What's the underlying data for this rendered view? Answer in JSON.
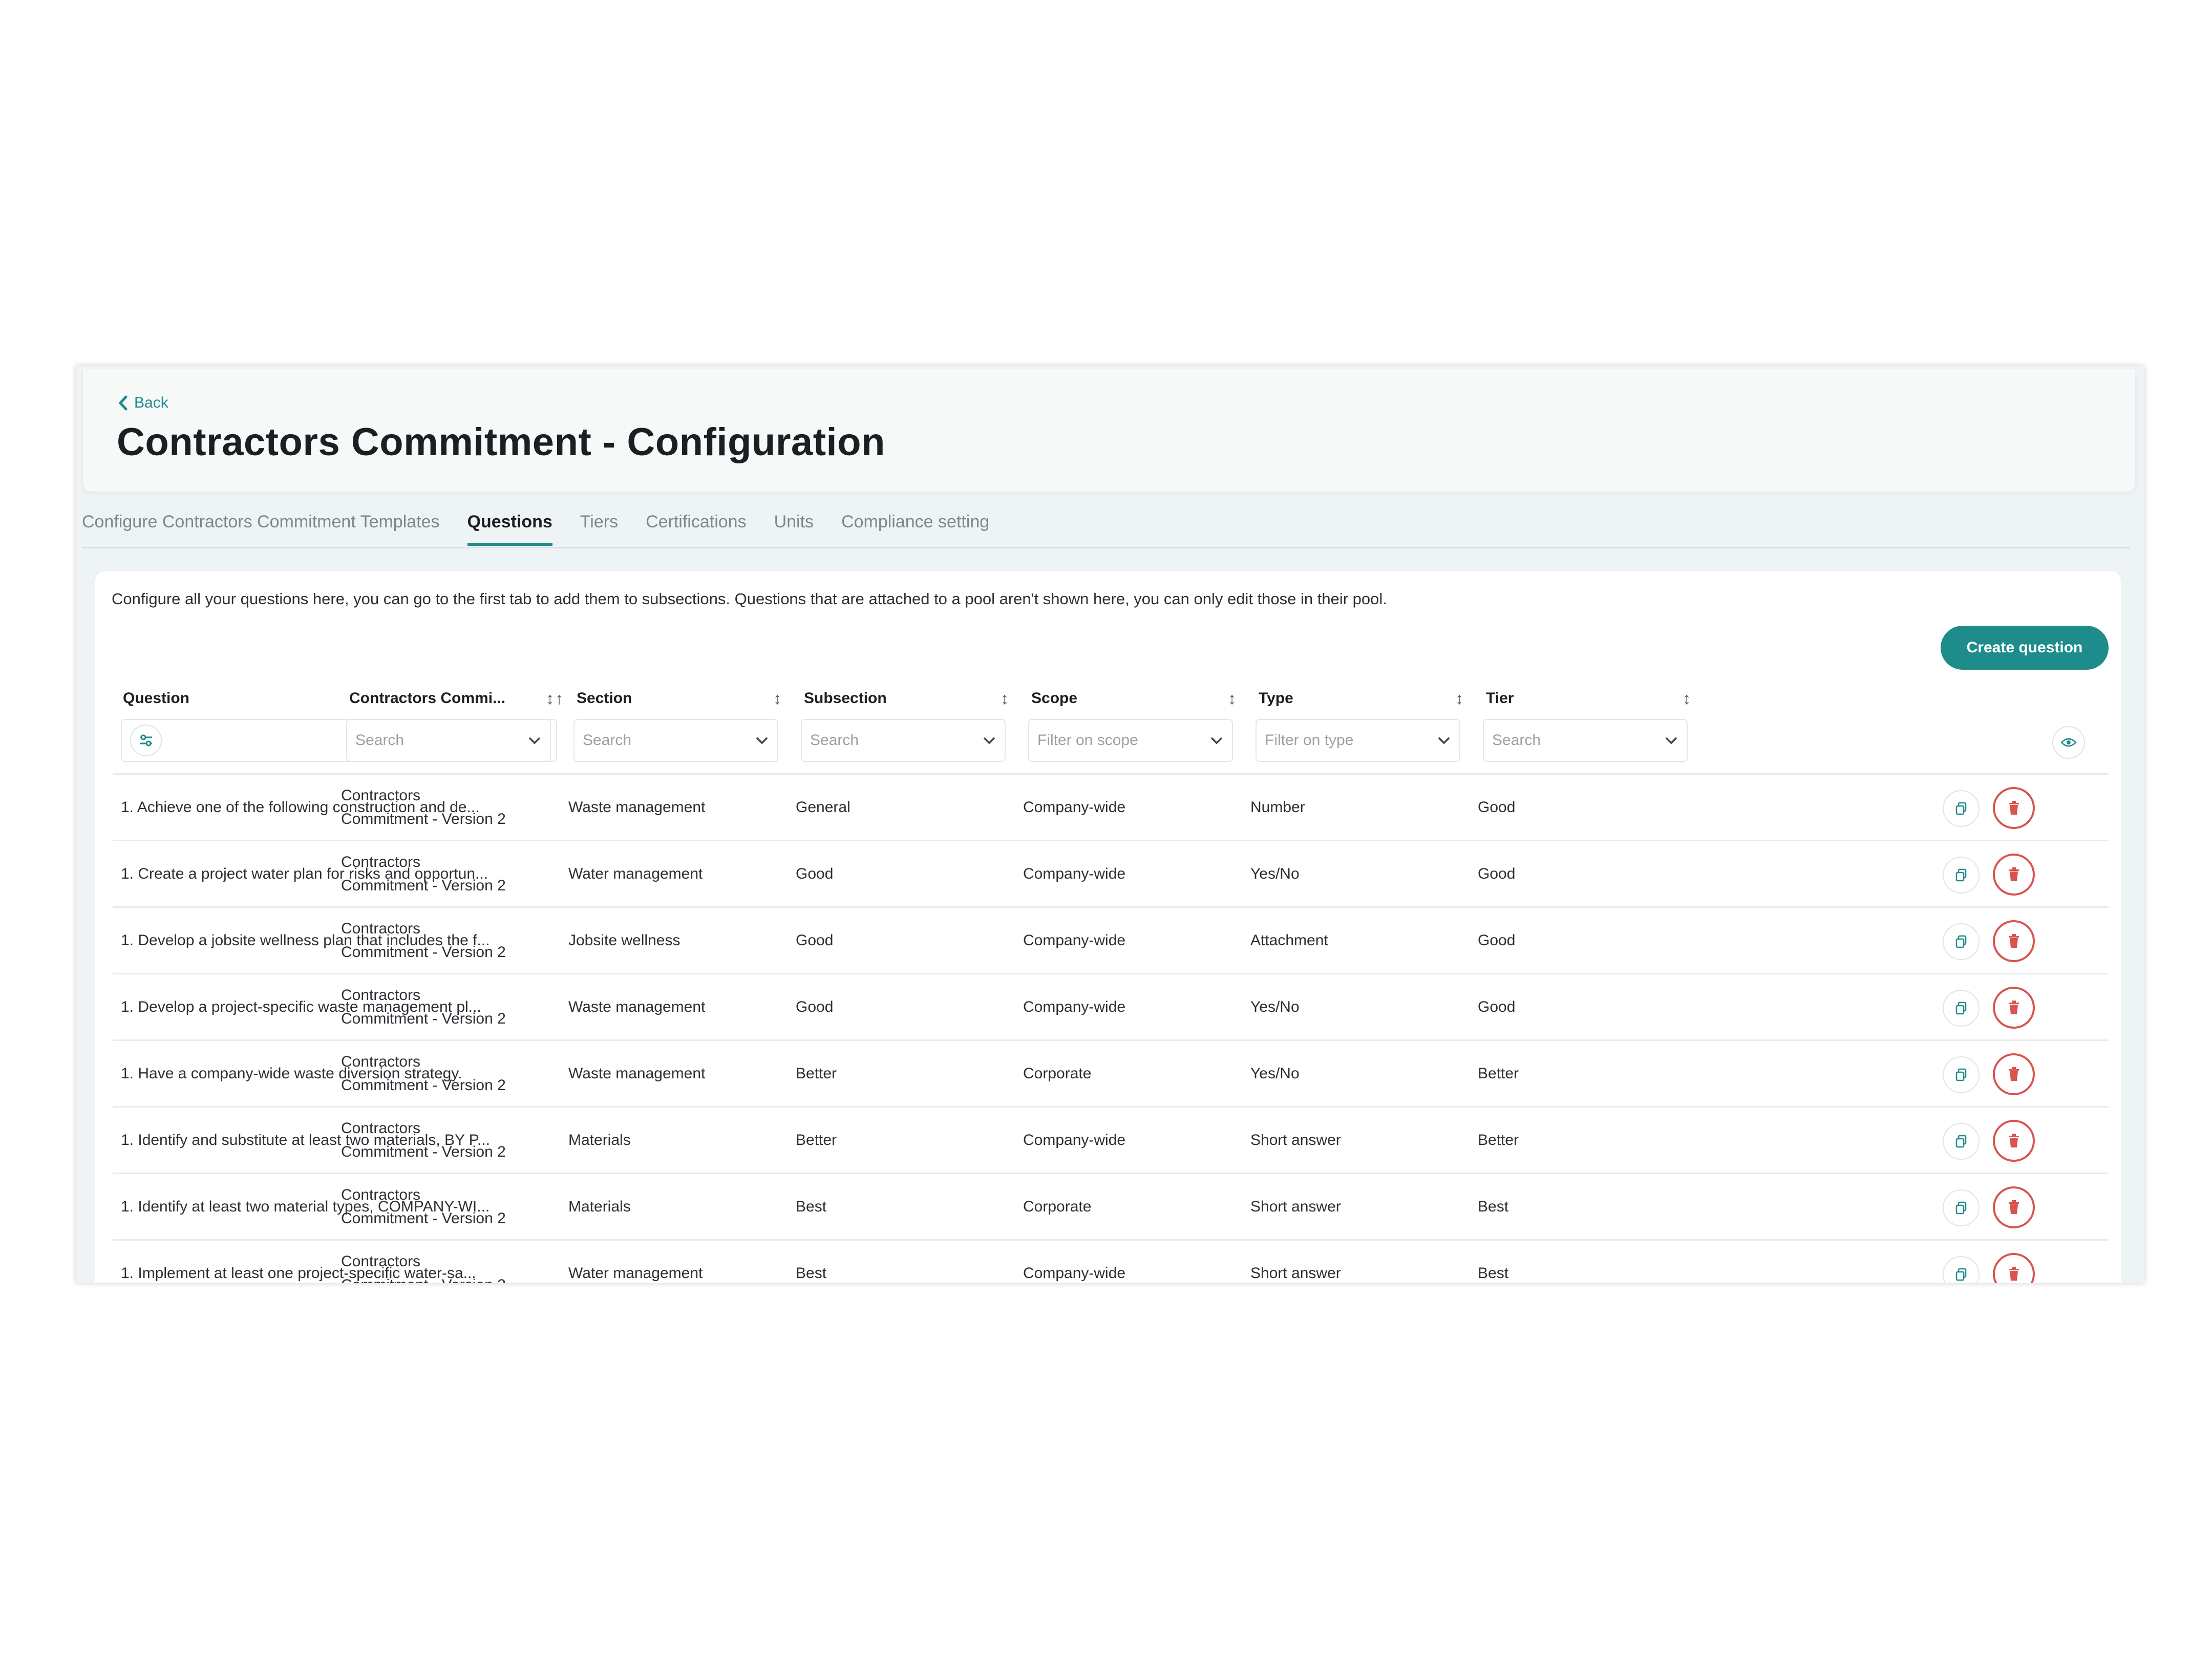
{
  "header": {
    "back_label": "Back",
    "title": "Contractors Commitment - Configuration"
  },
  "tabs": [
    {
      "label": "Configure Contractors Commitment Templates",
      "active": false
    },
    {
      "label": "Questions",
      "active": true
    },
    {
      "label": "Tiers",
      "active": false
    },
    {
      "label": "Certifications",
      "active": false
    },
    {
      "label": "Units",
      "active": false
    },
    {
      "label": "Compliance setting",
      "active": false
    }
  ],
  "main": {
    "description": "Configure all your questions here, you can go to the first tab to add them to subsections. Questions that are attached to a pool aren't shown here, you can only edit those in their pool.",
    "create_button_label": "Create question"
  },
  "table": {
    "columns": [
      {
        "key": "question",
        "label": "Question",
        "filter_placeholder": ""
      },
      {
        "key": "template",
        "label": "Contractors Commi...",
        "filter_placeholder": "Search"
      },
      {
        "key": "section",
        "label": "Section",
        "filter_placeholder": "Search"
      },
      {
        "key": "subsection",
        "label": "Subsection",
        "filter_placeholder": "Search"
      },
      {
        "key": "scope",
        "label": "Scope",
        "filter_placeholder": "Filter on scope"
      },
      {
        "key": "type",
        "label": "Type",
        "filter_placeholder": "Filter on type"
      },
      {
        "key": "tier",
        "label": "Tier",
        "filter_placeholder": "Search"
      }
    ],
    "rows": [
      {
        "question": "1. Achieve one of the following construction and de...",
        "template_line1": "Contractors",
        "template_line2": "Commitment - Version 2",
        "section": "Waste management",
        "subsection": "General",
        "scope": "Company-wide",
        "type": "Number",
        "tier": "Good"
      },
      {
        "question": "1. Create a project water plan for risks and opportun...",
        "template_line1": "Contractors",
        "template_line2": "Commitment - Version 2",
        "section": "Water management",
        "subsection": "Good",
        "scope": "Company-wide",
        "type": "Yes/No",
        "tier": "Good"
      },
      {
        "question": "1. Develop a jobsite wellness plan that includes the f...",
        "template_line1": "Contractors",
        "template_line2": "Commitment - Version 2",
        "section": "Jobsite wellness",
        "subsection": "Good",
        "scope": "Company-wide",
        "type": "Attachment",
        "tier": "Good"
      },
      {
        "question": "1. Develop a project-specific waste management pl...",
        "template_line1": "Contractors",
        "template_line2": "Commitment - Version 2",
        "section": "Waste management",
        "subsection": "Good",
        "scope": "Company-wide",
        "type": "Yes/No",
        "tier": "Good"
      },
      {
        "question": "1. Have a company-wide waste diversion strategy.",
        "template_line1": "Contractors",
        "template_line2": "Commitment - Version 2",
        "section": "Waste management",
        "subsection": "Better",
        "scope": "Corporate",
        "type": "Yes/No",
        "tier": "Better"
      },
      {
        "question": "1. Identify and substitute at least two materials, BY P...",
        "template_line1": "Contractors",
        "template_line2": "Commitment - Version 2",
        "section": "Materials",
        "subsection": "Better",
        "scope": "Company-wide",
        "type": "Short answer",
        "tier": "Better"
      },
      {
        "question": "1. Identify at least two material types, COMPANY-WI...",
        "template_line1": "Contractors",
        "template_line2": "Commitment - Version 2",
        "section": "Materials",
        "subsection": "Best",
        "scope": "Corporate",
        "type": "Short answer",
        "tier": "Best"
      },
      {
        "question": "1. Implement at least one project-specific water-sa...",
        "template_line1": "Contractors",
        "template_line2": "Commitment - Version 2",
        "section": "Water management",
        "subsection": "Best",
        "scope": "Company-wide",
        "type": "Short answer",
        "tier": "Best"
      }
    ]
  },
  "icons": {
    "back": "chevron-left-icon",
    "sort": "sort-icon",
    "dropdown": "chevron-down-icon",
    "filter_toggle": "sliders-icon",
    "column_visibility": "eye-icon",
    "copy": "copy-icon",
    "delete": "trash-icon"
  },
  "colors": {
    "accent": "#1e8c8a",
    "danger": "#d9534f",
    "background": "#eef4f5"
  }
}
